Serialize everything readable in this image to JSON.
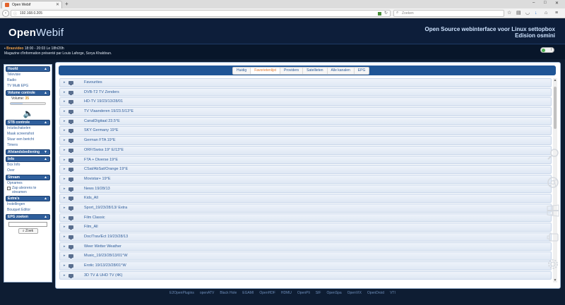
{
  "browser": {
    "tab_title": "Open Webif",
    "url": "192.168.0.205",
    "search_placeholder": "Zoeken",
    "new_tab": "+",
    "window_controls": [
      "–",
      "□",
      "✕"
    ]
  },
  "header": {
    "logo_open": "Open",
    "logo_webif": "Webif",
    "tagline_line1": "Open Source webinterface voor Linux settopbox",
    "tagline_line2": "Edision osmini"
  },
  "now": {
    "channel": "Brasvideo",
    "time_info": "18:00 - 20:03  Le 18h/20h",
    "description": "Magazine d'information présenté par Louis Laforge, Sorya Khaldoun.",
    "toggle_mark": "I"
  },
  "sidebar": {
    "sections": [
      {
        "title": "Hoofd",
        "links": [
          "Televisie",
          "Radio",
          "TV Multi EPG"
        ]
      },
      {
        "title": "Volume controle"
      },
      {
        "title": "STB controle",
        "links": [
          "In/uitschakelen",
          "Maak screenshot",
          "Stuur een bericht",
          "Timers"
        ]
      },
      {
        "title": "Afstandsbediening"
      },
      {
        "title": "Info",
        "links": [
          "Box Info",
          "Over"
        ]
      },
      {
        "title": "Stream",
        "links": [
          "Opnames"
        ]
      },
      {
        "title": "Extra's",
        "links": [
          "Instellingen",
          "Bouquet Editor"
        ]
      },
      {
        "title": "EPG zoeken"
      }
    ],
    "volume_label": "Volume:",
    "volume_value": "35",
    "volume_level": 0.35,
    "zap_label": "Zap alvorens te streamen",
    "zoek_label": "Zoek"
  },
  "main": {
    "tabs": [
      "Huidig",
      "Favorietenlijst",
      "Providers",
      "Satellieten",
      "Alle kanalen",
      "EPG"
    ],
    "active_tab": 1,
    "bouquets": [
      "Favourites",
      "DVB-T2 TV Zenders",
      "HD-TV 19/23/13/28/01",
      "TV Vlaanderen 19/23.5/13°E",
      "CanalDigitaal 23.5°E",
      "SKY Germany 19°E",
      "German FTA 19°E",
      "ORF/Swiss 19° E/13°E",
      "FTA + Diverse 19°E",
      "CSat/AbSat/Orange 19°E",
      "Movistar+ 19°E",
      "News 19/28/13",
      "Kids_All",
      "Sport_19/23/28/13/ Extra",
      "Film Classic",
      "Film_All",
      "Doc/Trav/Ect 19/23/28/13",
      "Weer Wetter Weather",
      "Music_19/23/28/13/01°W",
      "Erotic 19/13/23/28/01°W",
      "3D TV & UHD TV (4K)"
    ]
  },
  "footer": {
    "links": [
      "E2OpenPlugins",
      "openATV",
      "Black Hole",
      "EGAMI",
      "OpenHDF",
      "HDMU",
      "OpenPli",
      "SIF",
      "OpenSpa",
      "OpenVIX",
      "OpenDroid",
      "VTI"
    ]
  },
  "icons": {
    "side": [
      "magnifier-icon",
      "chrome-icon",
      "windows-icon",
      "remote-icon",
      "gear-icon"
    ]
  }
}
